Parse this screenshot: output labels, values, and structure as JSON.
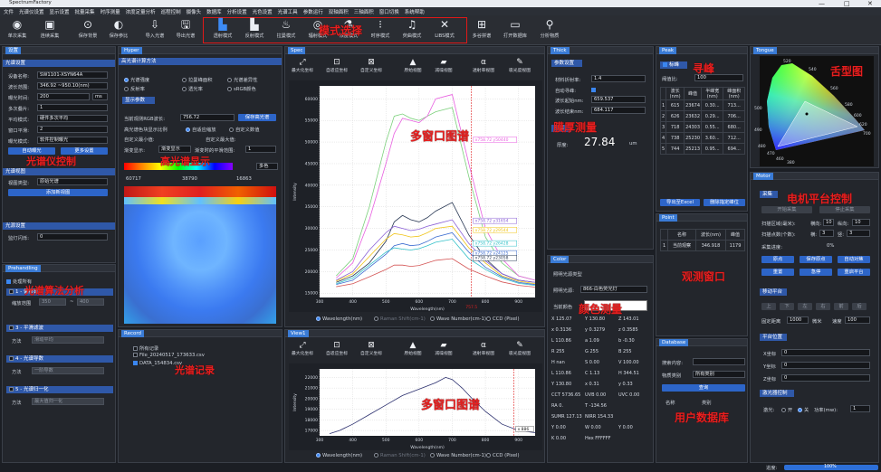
{
  "app": {
    "title": "SpectrumFactory",
    "min": "—",
    "max": "□",
    "close": "✕"
  },
  "menu": [
    "文件",
    "光谱仪设置",
    "显示设置",
    "批量采集",
    "时序测量",
    "浓度定量分析",
    "巡程控制",
    "摄像头",
    "数据库",
    "分析设置",
    "光色设置",
    "光谱工具",
    "参数运行",
    "双轴面积",
    "三轴面积",
    "窗口切换",
    "系统帮助"
  ],
  "toolbar": {
    "items": [
      {
        "label": "单次采集",
        "icon": "camera-icon"
      },
      {
        "label": "连续采集",
        "icon": "video-icon"
      },
      {
        "label": "保存背景",
        "icon": "save-bg-icon"
      },
      {
        "label": "保存参比",
        "icon": "save-ref-icon"
      },
      {
        "label": "导入光谱",
        "icon": "import-icon"
      },
      {
        "label": "导出光谱",
        "icon": "export-icon"
      },
      {
        "label": "透射模式",
        "icon": "transmit-icon"
      },
      {
        "label": "反射模式",
        "icon": "reflect-icon"
      },
      {
        "label": "拉曼模式",
        "icon": "raman-icon"
      },
      {
        "label": "辐射模式",
        "icon": "radiation-icon"
      },
      {
        "label": "浓度模式",
        "icon": "conc-icon"
      },
      {
        "label": "时序模式",
        "icon": "timeseq-icon"
      },
      {
        "label": "荧曲模式",
        "icon": "fluor-icon"
      },
      {
        "label": "LIBS模式",
        "icon": "libs-icon"
      },
      {
        "label": "多谷拼谱",
        "icon": "stitch-icon"
      },
      {
        "label": "打开数据库",
        "icon": "database-icon"
      },
      {
        "label": "分析物质",
        "icon": "analyze-icon"
      }
    ],
    "mode_note": "模式选择"
  },
  "left": {
    "tab": "设置",
    "sect1": "光谱设置",
    "device_label": "设备名称:",
    "device": "SW1101-XSYN64A",
    "range_label": "波长范围:",
    "range": "346.92 ~950.10(nm)",
    "exp_label": "曝光时间:",
    "exp": "200",
    "exp_unit": "ms",
    "avg_label": "多次叠片:",
    "avg": "1",
    "smooth_label": "平均模式:",
    "smooth": "硬件多次平均",
    "win_label": "窗口平滑:",
    "win": "2",
    "trig_label": "曝光模式:",
    "trig": "软件控制曝光",
    "btn_auto": "自动曝光",
    "btn_more": "更多设置",
    "note": "光谱仪控制",
    "sect2": "光谱视图",
    "view_label": "视图类型:",
    "view": "原始光谱",
    "btn_add": "添加新视图",
    "sect3": "光源设置",
    "flash_label": "监灯闪烁:",
    "flash": "0"
  },
  "prehandle": {
    "tab": "Prehandling",
    "all": "处理所有",
    "items": [
      {
        "label": "1 - 偏移算法",
        "fields": [
          "缩放范围",
          "350",
          "~",
          "400"
        ]
      },
      {
        "label": "3 - 平滑滤波",
        "fields": [
          "方法",
          "滑动平均"
        ]
      },
      {
        "label": "4 - 光谱导数",
        "fields": [
          "方法",
          "一阶导数"
        ]
      },
      {
        "label": "5 - 光谱归一化",
        "fields": [
          "方法",
          "最大值归一化"
        ]
      }
    ],
    "note": "光谱算法分析"
  },
  "hyper": {
    "tab": "Hyper",
    "sect1": "高光谱计算方法",
    "opts": [
      "光谱强度",
      "反射率",
      "拉曼峰面积",
      "透光率",
      "光谱差异性",
      "sRGB颜色"
    ],
    "sect2": "显示参数",
    "cur_label": "当前观测RGB波长:",
    "cur": "756.72",
    "btn_save": "保存高光谱",
    "hi_label": "高光谱色块显示比例",
    "hi_opts": [
      "自适应缩放",
      "自定义数值"
    ],
    "min_label": "自定义最小值:",
    "max_label": "自定义最大值:",
    "def_label": "渐变显示:",
    "def": "渐变显示",
    "time_label": "渐变时的平滑范围:",
    "time": "1",
    "more": "多色",
    "vals": [
      "60717",
      "38790",
      "16863"
    ],
    "note": "高光谱显示"
  },
  "record": {
    "tab": "Record",
    "items": [
      "所有记录",
      "File_20240517_173633.csv",
      "DATA_154834.csv"
    ],
    "note": "光谱记录"
  },
  "spec": {
    "tab": "Spec",
    "tools": [
      "最大化坐标",
      "自适应坐标",
      "自定义坐标",
      "原始视图",
      "减噪视图",
      "透射率视图",
      "吸光度视图"
    ],
    "ylabel": "Intensity",
    "xlabel": "Wavelength(nm)",
    "note": "多窗口图谱",
    "radios": [
      "Wavelength(nm)",
      "Raman Shift(cm-1)",
      "Wave Number(cm-1)",
      "CCD (Pixel)"
    ],
    "marker": "757.5"
  },
  "view1": {
    "tab": "View1",
    "tools": [
      "最大化坐标",
      "自适应坐标",
      "自定义坐标",
      "原始视图",
      "减噪视图",
      "透射率视图",
      "吸光度视图"
    ],
    "ylabel": "Intensity",
    "xlabel": "Wavelength(nm)",
    "note": "多窗口图谱",
    "radios": [
      "Wavelength(nm)",
      "Raman Shift(cm-1)",
      "Wave Number(cm-1)",
      "CCD (Pixel)"
    ]
  },
  "thick": {
    "tab": "Thick",
    "sect": "参数设置",
    "ri_label": "材料折射率:",
    "ri": "1.4",
    "auto_label": "自动寻峰:",
    "start_label": "波长起始nm:",
    "start": "659.537",
    "end_label": "波长结束nm:",
    "end": "684.117",
    "sect2": "测厚",
    "thick_label": "厚度:",
    "thick": "27.84",
    "unit": "um",
    "note": "膜厚测量"
  },
  "peak": {
    "tab": "Peak",
    "enable": "标峰",
    "thr_label": "阈值比:",
    "thr": "100",
    "head": [
      "",
      "波长(nm)",
      "峰值",
      "半峰宽(nm)",
      "峰面积(nm)"
    ],
    "rows": [
      [
        "1",
        "615",
        "23674",
        "0.30...",
        "713..."
      ],
      [
        "2",
        "626",
        "23632",
        "0.29...",
        "706..."
      ],
      [
        "3",
        "718",
        "24303",
        "0.55...",
        "680..."
      ],
      [
        "4",
        "738",
        "25230",
        "3.60...",
        "712..."
      ],
      [
        "5",
        "744",
        "25213",
        "0.95...",
        "694..."
      ]
    ],
    "btn1": "导出至Excel",
    "btn2": "删除指定峰位",
    "note": "寻峰"
  },
  "point": {
    "tab": "Point",
    "head": [
      "",
      "名称",
      "波长(nm)",
      "峰值"
    ],
    "rows": [
      [
        "1",
        "当前观察",
        "346.918",
        "1179"
      ]
    ],
    "note": "观测窗口"
  },
  "color": {
    "tab": "Color",
    "sect": "照明光源类型",
    "light_label": "照明光源:",
    "light": "866-白色荧光灯",
    "cur": "当前颜色",
    "values": [
      [
        "X 125.07",
        "Y 130.80",
        "Z 143.01"
      ],
      [
        "x 0.3136",
        "y 0.3279",
        "z 0.3585"
      ],
      [
        "L 110.86",
        "a 1.09",
        "b -0.30"
      ],
      [
        "R 255",
        "G 255",
        "B 255"
      ],
      [
        "H nan",
        "S 0.00",
        "V 100.00"
      ],
      [
        "L 110.86",
        "C 1.13",
        "H 344.51"
      ],
      [
        "Y 130.80",
        "x 0.31",
        "y 0.33"
      ],
      [
        "CCT 5736.65",
        "UVB 0.00",
        "UVC 0.00"
      ],
      [
        "RA 0.",
        "T -134.56",
        ""
      ],
      [
        "SUMR 127.13",
        "NIRR 154.33",
        ""
      ],
      [
        "Y 0.00",
        "W 0.00",
        "Y 0.00"
      ],
      [
        "K 0.00",
        "Hex FFFFFF",
        ""
      ]
    ],
    "note": "颜色测量"
  },
  "db": {
    "tab": "Database",
    "search_label": "搜索内容:",
    "type_label": "物质类别",
    "type": "所有类别",
    "btn": "查询",
    "head": [
      "名称",
      "类别"
    ],
    "note": "用户数据库"
  },
  "tongue": {
    "tab": "Tongue",
    "note": "舌型图",
    "ticks": [
      "520",
      "540",
      "560",
      "580",
      "600",
      "620",
      "700",
      "500",
      "490",
      "480",
      "470",
      "460",
      "380"
    ]
  },
  "motor": {
    "tab": "Motor",
    "sect": "采集",
    "btn_a": "开始采集",
    "btn_b": "停止采集",
    "scan_label": "扫描区域(毫米):",
    "x_label": "横向:",
    "x": "10",
    "y_label": "纵向:",
    "y": "10",
    "pts_label": "扫描点数(个数):",
    "px_label": "横:",
    "px": "3",
    "py_label": "竖:",
    "py": "3",
    "speed_label": "采集进度:",
    "speed": "0%",
    "btns": [
      "原点",
      "保存原点",
      "自动对焦",
      "重置",
      "急停",
      "重启平台"
    ],
    "sect2": "移动平台",
    "move_btns": [
      "上",
      "下",
      "左",
      "右",
      "前",
      "后"
    ],
    "fixed_label": "固定距离",
    "fixed": "1000",
    "fixed_unit": "微米",
    "v_label": "速度",
    "v": "100",
    "sect3": "平台位置",
    "xpos_label": "X坐标",
    "xpos": "0",
    "ypos_label": "Y坐标",
    "ypos": "0",
    "zpos_label": "Z坐标",
    "zpos": "0",
    "sect4": "激光器控制",
    "laser_label": "激光:",
    "laser_on": "开",
    "laser_off": "关",
    "power_label": "功率(mw):",
    "power": "1",
    "note": "电机平台控制"
  },
  "status": {
    "label": "进度:",
    "value": "100%"
  },
  "chart_data": [
    {
      "type": "line",
      "xlim": [
        300,
        950
      ],
      "ylim": [
        14000,
        63000
      ],
      "xticks": [
        "300",
        "400",
        "500",
        "600",
        "700",
        "800",
        "900"
      ],
      "yticks": [
        "15000",
        "20000",
        "25000",
        "30000",
        "35000",
        "40000",
        "45000",
        "50000",
        "55000",
        "60000"
      ],
      "series": [
        {
          "color": "#2b3a55",
          "x": [
            350,
            400,
            450,
            500,
            525,
            550,
            575,
            600,
            625,
            650,
            700,
            750,
            800,
            850,
            900,
            950
          ],
          "y": [
            17500,
            19000,
            22000,
            27000,
            31500,
            33000,
            32000,
            31500,
            32500,
            34000,
            36000,
            28500,
            23000,
            19500,
            18000,
            17500
          ]
        },
        {
          "color": "#3a6bd0",
          "x": [
            350,
            400,
            450,
            500,
            525,
            550,
            575,
            600,
            625,
            650,
            700,
            750,
            800,
            850,
            900,
            950
          ],
          "y": [
            17000,
            18000,
            21000,
            24000,
            26000,
            26500,
            26000,
            26200,
            27000,
            28000,
            29000,
            24500,
            21000,
            18800,
            17500,
            17000
          ]
        },
        {
          "color": "#7bd07b",
          "x": [
            350,
            400,
            450,
            500,
            525,
            550,
            575,
            600,
            625,
            650,
            700,
            750,
            800,
            850,
            900,
            950
          ],
          "y": [
            19000,
            23000,
            35000,
            50000,
            56000,
            56500,
            55500,
            55000,
            56000,
            57000,
            58000,
            42000,
            28000,
            22000,
            19000,
            18000
          ]
        },
        {
          "color": "#e85fe0",
          "x": [
            350,
            400,
            450,
            500,
            525,
            550,
            575,
            600,
            625,
            650,
            700,
            750,
            800,
            850,
            900,
            950
          ],
          "y": [
            18500,
            22000,
            32000,
            45000,
            52000,
            55500,
            55000,
            54500,
            56000,
            60000,
            61000,
            45000,
            30000,
            23000,
            19000,
            18000
          ]
        },
        {
          "color": "#8a5fd6",
          "x": [
            350,
            400,
            450,
            500,
            525,
            550,
            575,
            600,
            625,
            650,
            700,
            750,
            800,
            850,
            900,
            950
          ],
          "y": [
            18000,
            20000,
            25000,
            29000,
            30500,
            30000,
            29500,
            29800,
            30500,
            31000,
            32000,
            26500,
            22500,
            19500,
            18000,
            17500
          ]
        },
        {
          "color": "#f0c419",
          "x": [
            350,
            400,
            450,
            500,
            525,
            550,
            575,
            600,
            625,
            650,
            700,
            750,
            800,
            850,
            900,
            950
          ],
          "y": [
            17800,
            19500,
            23500,
            27500,
            28800,
            28500,
            28000,
            28200,
            29000,
            30000,
            30500,
            25500,
            22000,
            19000,
            17800,
            17200
          ]
        },
        {
          "color": "#33c1c9",
          "x": [
            350,
            400,
            450,
            500,
            525,
            550,
            575,
            600,
            625,
            650,
            700,
            750,
            800,
            850,
            900,
            950
          ],
          "y": [
            17200,
            18500,
            21500,
            24500,
            25500,
            25200,
            25000,
            25300,
            26000,
            26800,
            27500,
            23000,
            20500,
            18500,
            17300,
            16800
          ]
        },
        {
          "color": "#d45555",
          "x": [
            350,
            400,
            450,
            500,
            525,
            550,
            575,
            600,
            625,
            650,
            700,
            750,
            800,
            850,
            900,
            950
          ],
          "y": [
            16500,
            17200,
            18800,
            20500,
            21500,
            21500,
            21200,
            21400,
            22000,
            22600,
            23000,
            20600,
            19000,
            17600,
            16800,
            16400
          ]
        }
      ],
      "labels": [
        "x758.72 y50440",
        "x758.72 y31654",
        "x758.72 y29544",
        "x758.72 y26428",
        "x758.72 y24125",
        "x758.72 y23058"
      ]
    },
    {
      "type": "line",
      "xlim": [
        300,
        950
      ],
      "ylim": [
        16500,
        22800
      ],
      "xticks": [
        "300",
        "400",
        "500",
        "600",
        "700",
        "800",
        "900"
      ],
      "yticks": [
        "17000",
        "18000",
        "19000",
        "20000",
        "21000",
        "22000"
      ],
      "series": [
        {
          "color": "#2b2f6e",
          "x": [
            330,
            360,
            400,
            450,
            500,
            550,
            600,
            650,
            680,
            700,
            730,
            760,
            800,
            850,
            900,
            950
          ],
          "y": [
            16700,
            17000,
            17600,
            18500,
            19400,
            20300,
            20900,
            21500,
            22000,
            21800,
            21000,
            20000,
            18800,
            17600,
            17000,
            16800
          ]
        }
      ],
      "labels": [
        "x 886"
      ]
    }
  ]
}
